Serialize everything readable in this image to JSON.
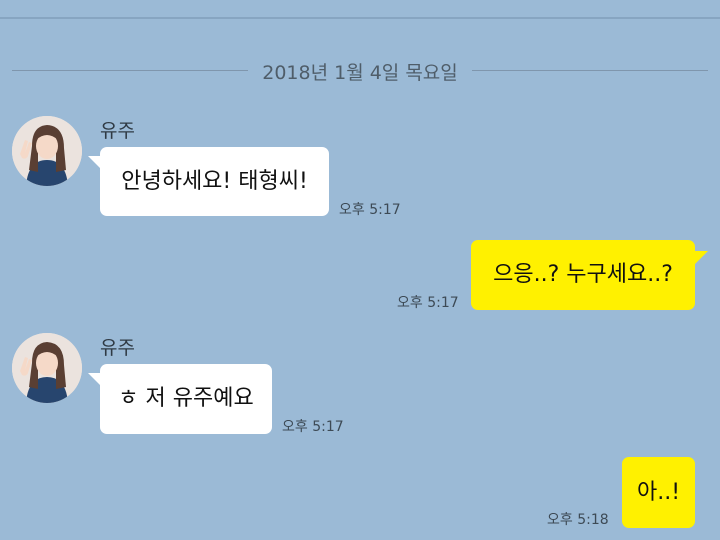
{
  "date_separator": "2018년 1월 4일 목요일",
  "messages": [
    {
      "sender": "유주",
      "text": "안녕하세요! 태형씨!",
      "time": "오후 5:17",
      "side": "incoming"
    },
    {
      "sender": "",
      "text": "으응..? 누구세요..?",
      "time": "오후 5:17",
      "side": "outgoing"
    },
    {
      "sender": "유주",
      "text": "ㅎ 저 유주예요",
      "time": "오후 5:17",
      "side": "incoming"
    },
    {
      "sender": "",
      "text": "아..!",
      "time": "오후 5:18",
      "side": "outgoing"
    }
  ],
  "colors": {
    "background": "#9bbad6",
    "incoming_bubble": "#ffffff",
    "outgoing_bubble": "#fff100"
  },
  "icons": {
    "avatar": "profile-photo"
  }
}
